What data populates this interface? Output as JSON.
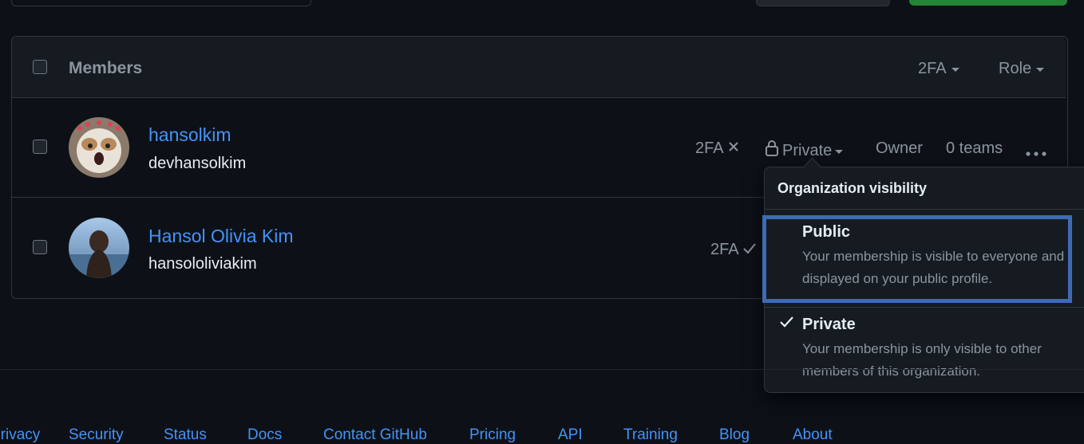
{
  "members": {
    "header_label": "Members",
    "filter_2fa": "2FA",
    "filter_role": "Role",
    "rows": [
      {
        "name": "hansolkim",
        "login": "devhansolkim",
        "twofa": "2FA",
        "visibility": "Private",
        "role": "Owner",
        "teams": "0 teams"
      },
      {
        "name": "Hansol Olivia Kim",
        "login": "hansololiviakim",
        "twofa": "2FA"
      }
    ]
  },
  "visibility_menu": {
    "title": "Organization visibility",
    "public": {
      "label": "Public",
      "line1": "Your membership is visible to everyone and",
      "line2": "displayed on your public profile."
    },
    "private": {
      "label": "Private",
      "line1": "Your membership is only visible to other",
      "line2": "members of this organization."
    }
  },
  "footer": {
    "links": [
      "Privacy",
      "Security",
      "Status",
      "Docs",
      "Contact GitHub",
      "Pricing",
      "API",
      "Training",
      "Blog",
      "About"
    ]
  },
  "colors": {
    "accent": "#4493f8",
    "highlight_box": "#3e6bb3",
    "background": "#0d1117"
  },
  "icons": [
    "lock-icon",
    "x-icon",
    "check-icon",
    "kebab-horizontal-icon",
    "triangle-down-icon"
  ]
}
